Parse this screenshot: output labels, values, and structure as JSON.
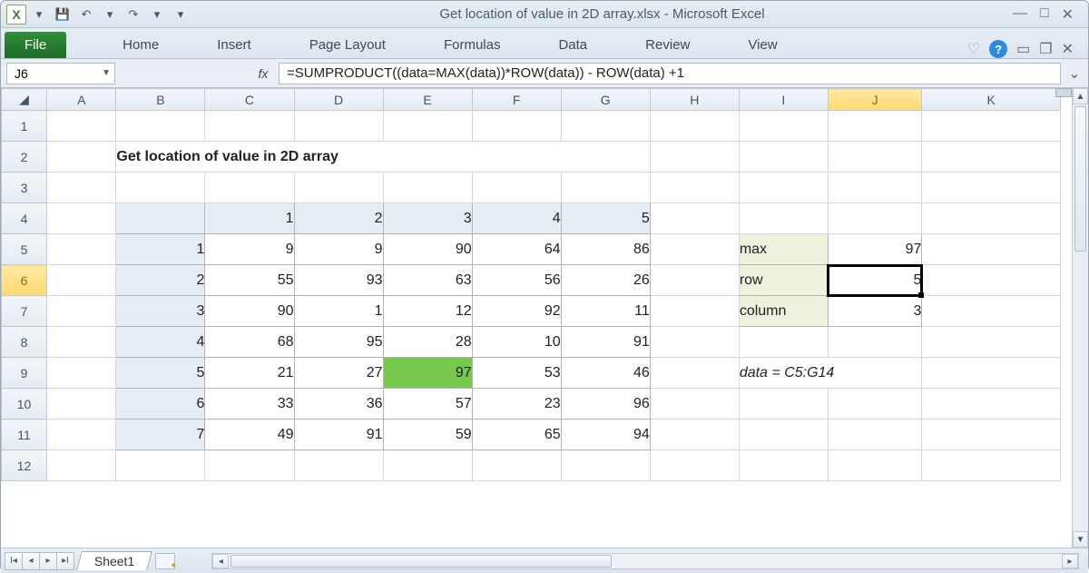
{
  "app": {
    "title": "Get location of value in 2D array.xlsx  -  Microsoft Excel"
  },
  "qat": {
    "save": "💾",
    "undo": "↶",
    "redo": "↷"
  },
  "win": {
    "min": "—",
    "max": "□",
    "close": "✕"
  },
  "tabs": {
    "file": "File",
    "home": "Home",
    "insert": "Insert",
    "page_layout": "Page Layout",
    "formulas": "Formulas",
    "data": "Data",
    "review": "Review",
    "view": "View"
  },
  "ribbon_right": {
    "caret": "♡",
    "help": "?",
    "min2": "▭",
    "rest": "❐",
    "close2": "✕"
  },
  "fbar": {
    "namebox": "J6",
    "fx": "fx",
    "formula": "=SUMPRODUCT((data=MAX(data))*ROW(data)) - ROW(data) +1"
  },
  "columns": [
    "A",
    "B",
    "C",
    "D",
    "E",
    "F",
    "G",
    "H",
    "I",
    "J",
    "K"
  ],
  "active": {
    "col": "J",
    "row": 6
  },
  "content": {
    "title": "Get location of value in 2D array",
    "col_headers": [
      "1",
      "2",
      "3",
      "4",
      "5"
    ],
    "row_headers": [
      "1",
      "2",
      "3",
      "4",
      "5",
      "6",
      "7"
    ],
    "data": [
      [
        9,
        9,
        90,
        64,
        86
      ],
      [
        55,
        93,
        63,
        56,
        26
      ],
      [
        90,
        1,
        12,
        92,
        11
      ],
      [
        68,
        95,
        28,
        10,
        91
      ],
      [
        21,
        27,
        97,
        53,
        46
      ],
      [
        33,
        36,
        57,
        23,
        96
      ],
      [
        49,
        91,
        59,
        65,
        94
      ]
    ],
    "max_highlight": {
      "row": 4,
      "col": 2
    },
    "summary": {
      "labels": {
        "max": "max",
        "row": "row",
        "column": "column"
      },
      "values": {
        "max": 97,
        "row": 5,
        "column": 3
      }
    },
    "note": "data = C5:G14"
  },
  "sheet_tab": "Sheet1"
}
